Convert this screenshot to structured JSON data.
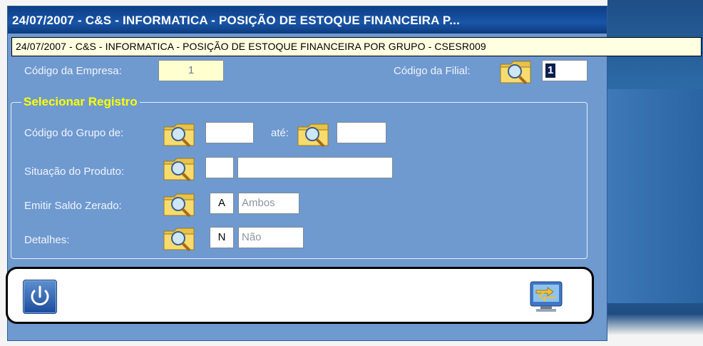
{
  "window": {
    "title": "24/07/2007  -  C&S - INFORMATICA  -  POSIÇÃO DE ESTOQUE FINANCEIRA P...",
    "tooltip": "24/07/2007  -  C&S - INFORMATICA  -  POSIÇÃO DE ESTOQUE FINANCEIRA POR GRUPO  -  CSESR009"
  },
  "header": {
    "empresa_label": "Código da Empresa:",
    "empresa_value": "1",
    "filial_label": "Código da Filial:",
    "filial_value": "1"
  },
  "selection": {
    "title": "Selecionar Registro",
    "grupo_label": "Código do Grupo de:",
    "grupo_from": "",
    "ate_label": "até:",
    "grupo_to": "",
    "situacao_label": "Situação do Produto:",
    "situacao_code": "",
    "situacao_desc": "",
    "saldo_label": "Emitir Saldo Zerado:",
    "saldo_code": "A",
    "saldo_desc": "Ambos",
    "detalhes_label": "Detalhes:",
    "detalhes_code": "N",
    "detalhes_desc": "Não"
  },
  "icons": {
    "lookup": "folder-magnifier-icon",
    "power": "power-icon",
    "transfer": "monitor-transfer-icon"
  },
  "colors": {
    "window_bg": "#6f9ad0",
    "titlebar": "#1955a8",
    "group_title": "#ffff00",
    "tooltip_bg": "#ffffe1"
  }
}
